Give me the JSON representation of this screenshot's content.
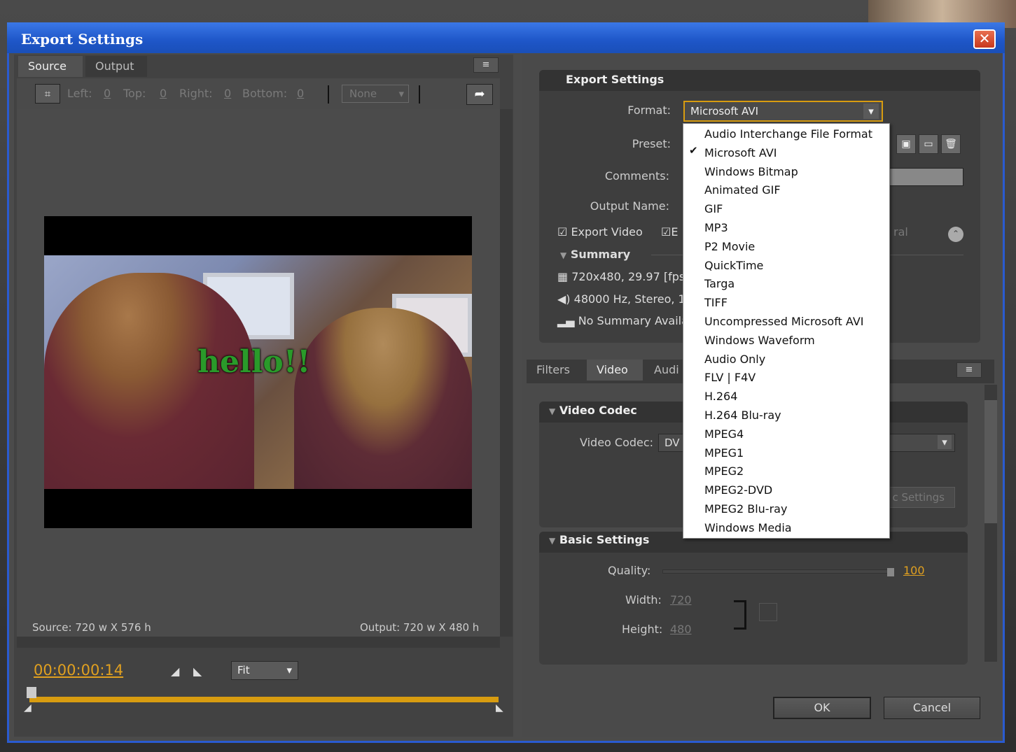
{
  "dialog": {
    "title": "Export Settings",
    "close": "✕"
  },
  "left": {
    "tabs": [
      "Source",
      "Output"
    ],
    "menu_icon": "≡",
    "crop": {
      "left_label": "Left:",
      "left_val": "0",
      "top_label": "Top:",
      "top_val": "0",
      "right_label": "Right:",
      "right_val": "0",
      "bottom_label": "Bottom:",
      "bottom_val": "0",
      "aspect": "None"
    },
    "video_overlay_text": "hello!!",
    "source_info": "Source: 720 w X 576 h",
    "output_info": "Output: 720 w X 480 h",
    "timecode": "00:00:00:14",
    "zoom": "Fit"
  },
  "export": {
    "section_title": "Export Settings",
    "format_label": "Format:",
    "format_value": "Microsoft AVI",
    "preset_label": "Preset:",
    "comments_label": "Comments:",
    "output_name_label": "Output Name:",
    "export_video": "Export Video",
    "export_audio_initial": "E",
    "ral": "ral",
    "summary_title": "Summary",
    "summary": [
      "720x480, 29.97 [fps",
      "48000 Hz, Stereo, 1",
      "No Summary Availab"
    ]
  },
  "format_options": [
    "Audio Interchange File Format",
    "Microsoft AVI",
    "Windows Bitmap",
    "Animated GIF",
    "GIF",
    "MP3",
    "P2 Movie",
    "QuickTime",
    "Targa",
    "TIFF",
    "Uncompressed Microsoft AVI",
    "Windows Waveform",
    "Audio Only",
    "FLV | F4V",
    "H.264",
    "H.264 Blu-ray",
    "MPEG4",
    "MPEG1",
    "MPEG2",
    "MPEG2-DVD",
    "MPEG2 Blu-ray",
    "Windows Media"
  ],
  "selected_format_index": 1,
  "lower_tabs": [
    "Filters",
    "Video",
    "Audi"
  ],
  "video_codec": {
    "title": "Video Codec",
    "label": "Video Codec:",
    "value": "DV",
    "settings_button": "c Settings"
  },
  "basic_settings": {
    "title": "Basic Settings",
    "quality_label": "Quality:",
    "quality_value": "100",
    "width_label": "Width:",
    "width_value": "720",
    "height_label": "Height:",
    "height_value": "480"
  },
  "buttons": {
    "ok": "OK",
    "cancel": "Cancel"
  },
  "colors": {
    "accent": "#d89c10",
    "titlebar": "#1e56c8"
  }
}
